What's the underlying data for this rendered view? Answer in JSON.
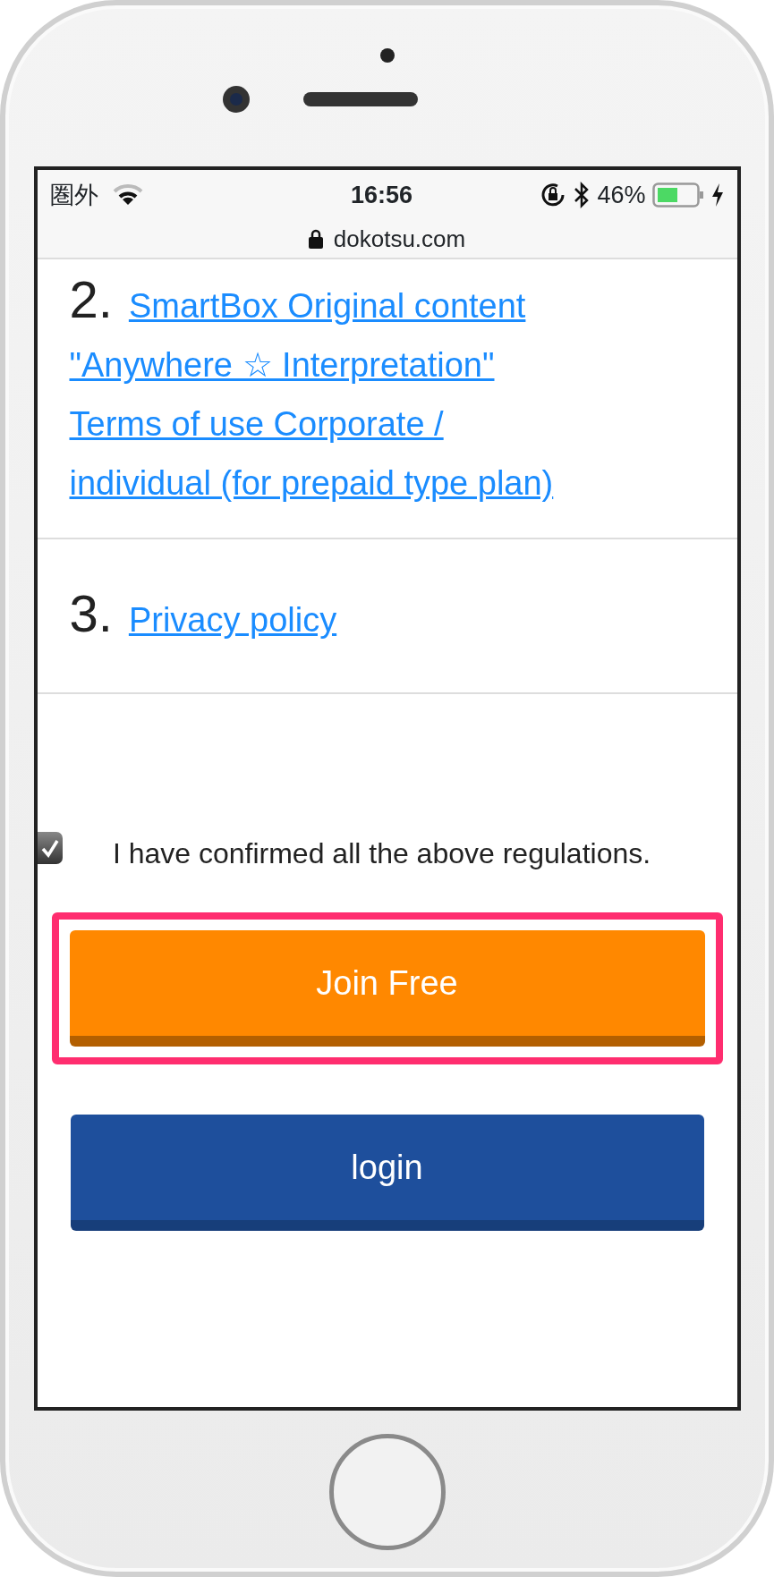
{
  "status_bar": {
    "carrier": "圏外",
    "time": "16:56",
    "battery": "46%",
    "url": "dokotsu.com"
  },
  "terms": [
    {
      "number": "2.",
      "link_lines": [
        "SmartBox Original content",
        "\"Anywhere ☆ Interpretation\"",
        "Terms of use Corporate /",
        "individual (for prepaid type plan)"
      ]
    },
    {
      "number": "3.",
      "link_lines": [
        "Privacy policy"
      ]
    }
  ],
  "confirm": {
    "checked": true,
    "label": "I have confirmed all the above regulations."
  },
  "buttons": [
    {
      "label": "Join Free",
      "kind": "join",
      "highlighted": true
    },
    {
      "label": "login",
      "kind": "login",
      "highlighted": false
    }
  ]
}
